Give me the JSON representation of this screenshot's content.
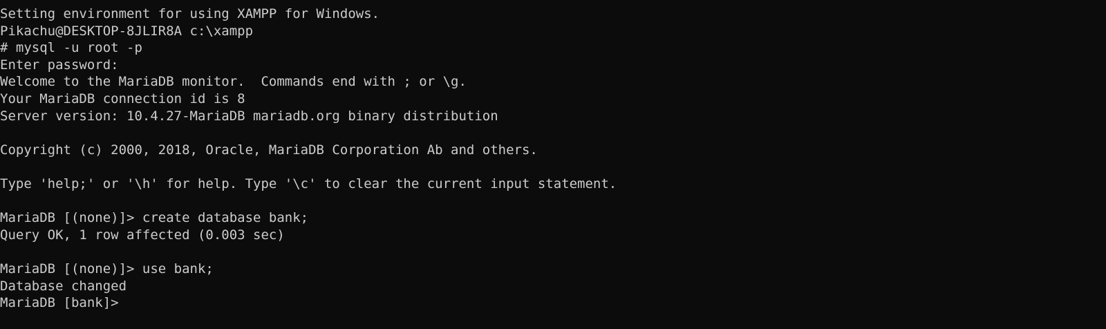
{
  "terminal": {
    "lines": [
      "Setting environment for using XAMPP for Windows.",
      "Pikachu@DESKTOP-8JLIR8A c:\\xampp",
      "# mysql -u root -p",
      "Enter password:",
      "Welcome to the MariaDB monitor.  Commands end with ; or \\g.",
      "Your MariaDB connection id is 8",
      "Server version: 10.4.27-MariaDB mariadb.org binary distribution",
      "",
      "Copyright (c) 2000, 2018, Oracle, MariaDB Corporation Ab and others.",
      "",
      "Type 'help;' or '\\h' for help. Type '\\c' to clear the current input statement.",
      "",
      "MariaDB [(none)]> create database bank;",
      "Query OK, 1 row affected (0.003 sec)",
      "",
      "MariaDB [(none)]> use bank;",
      "Database changed"
    ],
    "prompt": "MariaDB [bank]>",
    "input_value": "",
    "colors": {
      "background": "#0c0c0c",
      "foreground": "#cccccc"
    }
  }
}
